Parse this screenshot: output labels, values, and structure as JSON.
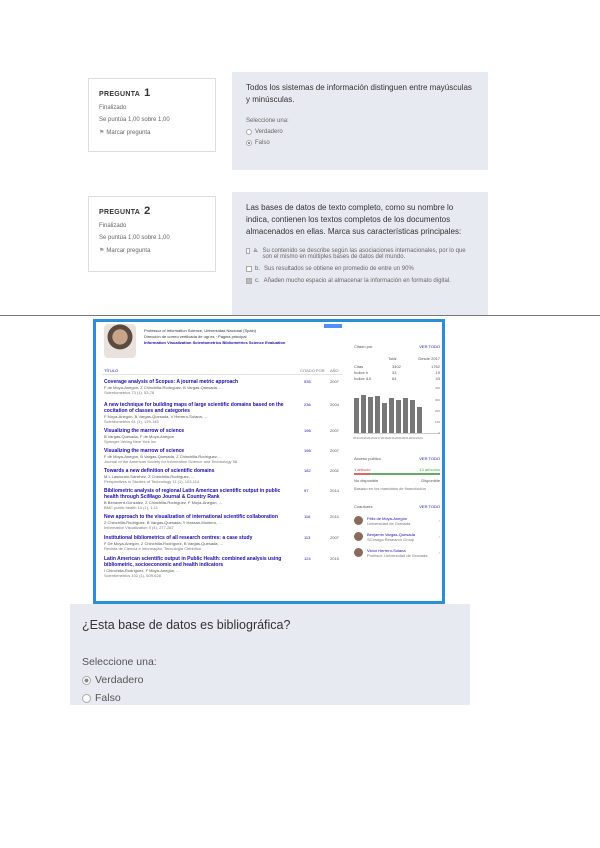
{
  "q1": {
    "label": "PREGUNTA",
    "number": "1",
    "status": "Finalizado",
    "score": "Se puntúa 1,00 sobre 1,00",
    "flag_label": "Marcar pregunta",
    "text": "Todos los sistemas de información distinguen entre mayúsculas y minúsculas.",
    "select_label": "Seleccione una:",
    "options": [
      "Verdadero",
      "Falso"
    ]
  },
  "q2": {
    "label": "PREGUNTA",
    "number": "2",
    "status": "Finalizado",
    "score": "Se puntúa 1,00 sobre 1,00",
    "flag_label": "Marcar pregunta",
    "text": "Las bases de datos de texto completo, como su nombre lo indica, contienen los textos completos de los documentos almacenados en ellas. Marca sus características principales:",
    "options": [
      {
        "letter": "a.",
        "text": "Su contenido se describe según las asociaciones internacionales, por lo que son el mismo en múltiples bases de datos del mundo."
      },
      {
        "letter": "b.",
        "text": "Sus resultados se obtiene en promedio de entre un 90%"
      },
      {
        "letter": "c.",
        "text": "Añaden mucho espacio al almacenar la información en formato digital."
      }
    ]
  },
  "screenshot": {
    "profile": {
      "line1": "Professor of Information Science, Universidad Nacional (Spain)",
      "line2": "Dirección de correo verificada de ugr.es · Página principal",
      "links": "Information Visualization   Scientometrics   Bibliometrics   Science Evaluation"
    },
    "table_headers": {
      "title": "TÍTULO",
      "cited": "CITADO POR",
      "year": "AÑO"
    },
    "articles": [
      {
        "title": "Coverage analysis of Scopus: A journal metric approach",
        "authors": "F de Moya-Anegón, Z Chinchilla-Rodríguez, B Vargas-Quesada, ...",
        "journal": "Scientometrics 73 (1), 53-78",
        "cited": "535",
        "year": "2007"
      },
      {
        "title": "A new technique for building maps of large scientific domains based on the cocitation of classes and categories",
        "authors": "F Moya-Anegón, B Vargas-Quesada, V Herrero-Solana, ...",
        "journal": "Scientometrics 61 (1), 129-145",
        "cited": "236",
        "year": "2004"
      },
      {
        "title": "Visualizing the marrow of science",
        "authors": "B Vargas-Quesada, F de Moya-Anegón",
        "journal": "Springer-Verlag New York Inc",
        "cited": "196",
        "year": "2007"
      },
      {
        "title": "Visualizing the marrow of science",
        "authors": "F de Moya-Anegón, B Vargas-Quesada, Z Chinchilla-Rodríguez, ...",
        "journal": "Journal of the American Society for Information Science and Technology 58",
        "cited": "196",
        "year": "2007"
      },
      {
        "title": "Towards a new definition of scientific domains",
        "authors": "M L Lascurain-Sánchez, Z Chinchilla-Rodríguez, ...",
        "journal": "Perspectives in Studies of Technology 11 (1), 103-114",
        "cited": "182",
        "year": "2002"
      },
      {
        "title": "Bibliometric analysis of regional Latin American scientific output in public health through SciMago Journal & Country Rank",
        "authors": "B Benavent-González, Z Chinchilla-Rodríguez, F Moya-Anegón, ...",
        "journal": "BMC public health 14 (1), 1-11",
        "cited": "97",
        "year": "2014"
      },
      {
        "title": "New approach to the visualization of international scientific collaboration",
        "authors": "Z Chinchilla-Rodríguez, B Vargas-Quesada, Y Hassan-Montero, ...",
        "journal": "Information Visualization 9 (4), 277-287",
        "cited": "116",
        "year": "2010"
      },
      {
        "title": "Institutional bibliometrics of all research centres: a case study",
        "authors": "F De Moya-Anegón, Z Chinchilla-Rodríguez, B Vargas-Quesada, ...",
        "journal": "Revista de Ciencia e Informação, Tecnologia Científica",
        "cited": "113",
        "year": "2007"
      },
      {
        "title": "Latin American scientific output in Public Health: combined analysis using bibliometric, socioeconomic and health indicators",
        "authors": "I Chinchilla-Rodríguez, F Moya-Anegón, ...",
        "journal": "Scientometrics 102 (1), 609-628",
        "cited": "124",
        "year": "2015"
      }
    ],
    "sidebar": {
      "cited_by_label": "Citado por",
      "view_all": "VER TODO",
      "col_total": "Total",
      "col_since": "Desde 2017",
      "stats": [
        {
          "label": "Citas",
          "total": "3402",
          "since": "1762"
        },
        {
          "label": "Índice h",
          "total": "33",
          "since": "19"
        },
        {
          "label": "Índice i10",
          "total": "64",
          "since": "43"
        }
      ],
      "chart_data": {
        "type": "bar",
        "categories": [
          "2014",
          "2015",
          "2016",
          "2017",
          "2018",
          "2019",
          "2020",
          "2021",
          "2022",
          "2023"
        ],
        "values": [
          300,
          330,
          310,
          320,
          260,
          300,
          290,
          300,
          290,
          230
        ],
        "ylim": [
          0,
          400
        ],
        "yticks": [
          "400",
          "300",
          "200",
          "100",
          "0"
        ]
      },
      "public_access_label": "Acceso público",
      "public_access_view": "VER TODO",
      "not_available_label": "1 artículo",
      "available_label": "13 artículos",
      "not_available": "No disponible",
      "available": "Disponible",
      "mandate_note": "Basado en los mandatos de financiación",
      "coauthors_label": "Coautores",
      "coauthors_view": "VER TODO",
      "coauthors": [
        {
          "name": "Félix de Moya-Anegón",
          "affiliation": "Universidad de Granada"
        },
        {
          "name": "Benjamín Vargas-Quesada",
          "affiliation": "SCImago Research Group"
        },
        {
          "name": "Victor Herrero-Solana",
          "affiliation": "Profesor, Universidad de Granada"
        }
      ]
    }
  },
  "q3": {
    "text": "¿Esta base de datos es bibliográfica?",
    "select_label": "Seleccione una:",
    "options": [
      "Verdadero",
      "Falso"
    ]
  }
}
